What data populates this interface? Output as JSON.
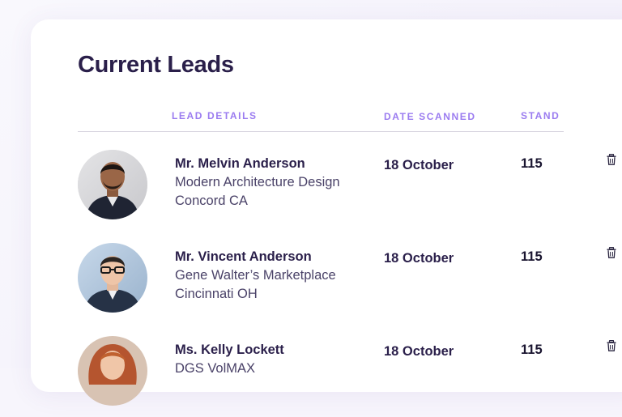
{
  "page": {
    "title": "Current Leads"
  },
  "table": {
    "headers": {
      "lead_details": "LEAD DETAILS",
      "date_scanned": "DATE SCANNED",
      "stand": "STAND"
    },
    "rows": [
      {
        "name": "Mr. Melvin Anderson",
        "company": "Modern Architecture Design",
        "location": "Concord CA",
        "date": "18 October",
        "stand": "115",
        "icon": "trash-icon"
      },
      {
        "name": "Mr. Vincent Anderson",
        "company": "Gene Walter’s Marketplace",
        "location": "Cincinnati OH",
        "date": "18 October",
        "stand": "115",
        "icon": "trash-icon"
      },
      {
        "name": "Ms. Kelly Lockett",
        "company": "DGS VolMAX",
        "location": "",
        "date": "18 October",
        "stand": "115",
        "icon": "trash-icon"
      }
    ]
  },
  "colors": {
    "accent": "#9b7cf0",
    "heading": "#2a1f4a",
    "text": "#4a4268"
  }
}
